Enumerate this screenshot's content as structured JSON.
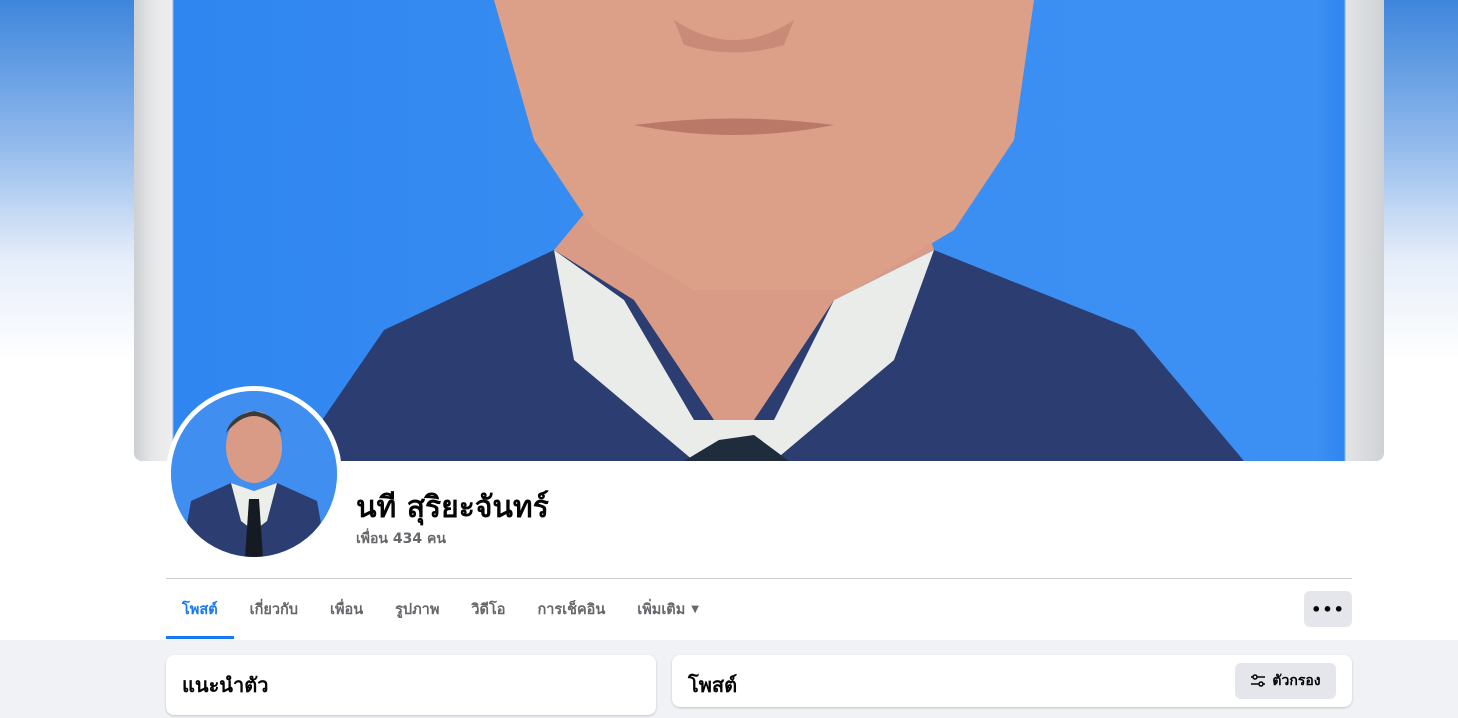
{
  "profile": {
    "name": "นที สุริยะจันทร์",
    "friends_count": "เพื่อน 434 คน"
  },
  "tabs": [
    {
      "label": "โพสต์",
      "active": true
    },
    {
      "label": "เกี่ยวกับ",
      "active": false
    },
    {
      "label": "เพื่อน",
      "active": false
    },
    {
      "label": "รูปภาพ",
      "active": false
    },
    {
      "label": "วิดีโอ",
      "active": false
    },
    {
      "label": "การเช็คอิน",
      "active": false
    },
    {
      "label": "เพิ่มเติม",
      "active": false
    }
  ],
  "more_button": {
    "label": "•••",
    "icon": "ellipsis-icon"
  },
  "intro": {
    "title": "แนะนำตัว"
  },
  "posts": {
    "title": "โพสต์",
    "filter_label": "ตัวกรอง",
    "filter_icon": "sliders-icon"
  },
  "colors": {
    "accent": "#1877f2",
    "muted_text": "#65676b",
    "button_bg": "#e4e6eb",
    "page_bg": "#f0f2f5"
  }
}
